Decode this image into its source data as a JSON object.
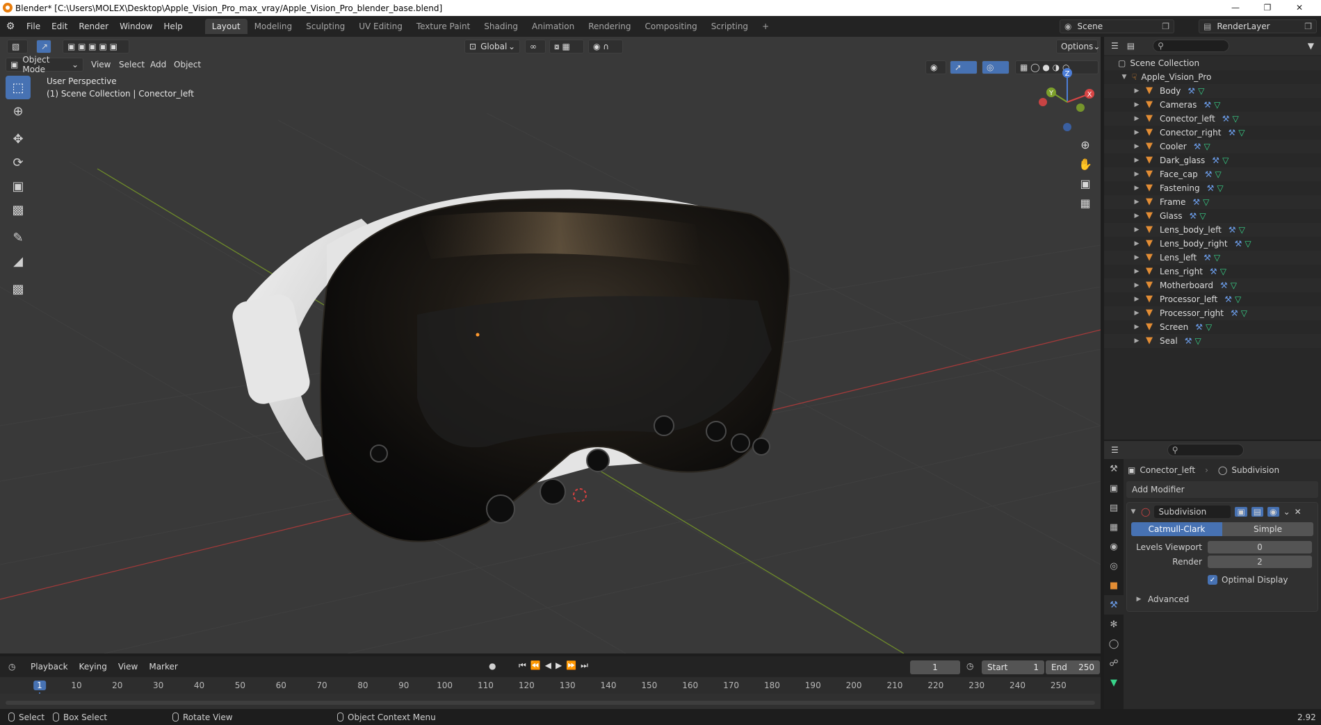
{
  "window": {
    "title": "Blender* [C:\\Users\\MOLEX\\Desktop\\Apple_Vision_Pro_max_vray/Apple_Vision_Pro_blender_base.blend]"
  },
  "menubar": {
    "menus": [
      "File",
      "Edit",
      "Render",
      "Window",
      "Help"
    ],
    "workspaces": [
      "Layout",
      "Modeling",
      "Sculpting",
      "UV Editing",
      "Texture Paint",
      "Shading",
      "Animation",
      "Rendering",
      "Compositing",
      "Scripting"
    ],
    "active_workspace": "Layout",
    "add_tab": "+",
    "scene": "Scene",
    "render_layer": "RenderLayer"
  },
  "viewport": {
    "mode": "Object Mode",
    "menus": [
      "View",
      "Select",
      "Add",
      "Object"
    ],
    "orientation": "Global",
    "options_label": "Options",
    "overlay_title": "User Perspective",
    "overlay_subtitle": "(1) Scene Collection | Conector_left",
    "gizmo": {
      "x": "X",
      "y": "Y",
      "z": "Z"
    }
  },
  "outliner": {
    "root": "Scene Collection",
    "collection": "Apple_Vision_Pro",
    "objects": [
      "Body",
      "Cameras",
      "Conector_left",
      "Conector_right",
      "Cooler",
      "Dark_glass",
      "Face_cap",
      "Fastening",
      "Frame",
      "Glass",
      "Lens_body_left",
      "Lens_body_right",
      "Lens_left",
      "Lens_right",
      "Motherboard",
      "Processor_left",
      "Processor_right",
      "Screen",
      "Seal"
    ],
    "selected": "Conector_left"
  },
  "properties": {
    "object": "Conector_left",
    "modifier_crumb": "Subdivision",
    "add_modifier": "Add Modifier",
    "modifier": {
      "name": "Subdivision",
      "type_options": [
        "Catmull-Clark",
        "Simple"
      ],
      "active_type": "Catmull-Clark",
      "levels_viewport_label": "Levels Viewport",
      "levels_viewport": "0",
      "render_label": "Render",
      "render": "2",
      "optimal_display_label": "Optimal Display",
      "optimal_display": true,
      "advanced_label": "Advanced"
    }
  },
  "timeline": {
    "menus": [
      "Playback",
      "Keying",
      "View",
      "Marker"
    ],
    "current_frame": "1",
    "start_label": "Start",
    "start": "1",
    "end_label": "End",
    "end": "250",
    "ticks": [
      "1",
      "10",
      "20",
      "30",
      "40",
      "50",
      "60",
      "70",
      "80",
      "90",
      "100",
      "110",
      "120",
      "130",
      "140",
      "150",
      "160",
      "170",
      "180",
      "190",
      "200",
      "210",
      "220",
      "230",
      "240",
      "250"
    ]
  },
  "statusbar": {
    "select": "Select",
    "box_select": "Box Select",
    "rotate_view": "Rotate View",
    "context_menu": "Object Context Menu",
    "version": "2.92"
  },
  "colors": {
    "accent": "#4772b3",
    "object_icon": "#e38d34",
    "modifier_icon": "#6b9ce8",
    "mesh_icon": "#38d48a",
    "x_axis": "#c23b3b",
    "y_axis": "#7a9a2c"
  }
}
